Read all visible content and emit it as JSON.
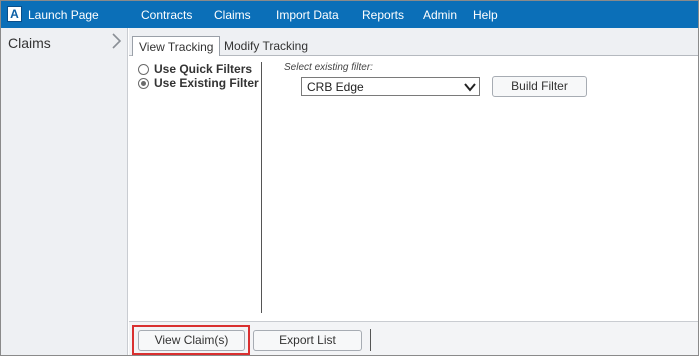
{
  "topbar": {
    "logo_letter": "A",
    "launch_label": "Launch Page",
    "nav": [
      {
        "label": "Contracts"
      },
      {
        "label": "Claims"
      },
      {
        "label": "Import Data"
      },
      {
        "label": "Reports"
      },
      {
        "label": "Admin"
      },
      {
        "label": "Help"
      }
    ],
    "color": "#0b6fb8"
  },
  "sidebar": {
    "title": "Claims",
    "toggle_icon": "chevron-right-icon"
  },
  "tabs": [
    {
      "label": "View Tracking",
      "active": true
    },
    {
      "label": "Modify Tracking",
      "active": false
    }
  ],
  "filters": {
    "options": [
      {
        "label": "Use Quick Filters",
        "checked": false
      },
      {
        "label": "Use Existing Filter",
        "checked": true
      }
    ],
    "select_caption": "Select existing filter:",
    "selected_filter": "CRB Edge",
    "build_button": "Build Filter"
  },
  "bottom": {
    "view_button": "View Claim(s)",
    "export_button": "Export List",
    "highlight_color": "#d93030"
  }
}
